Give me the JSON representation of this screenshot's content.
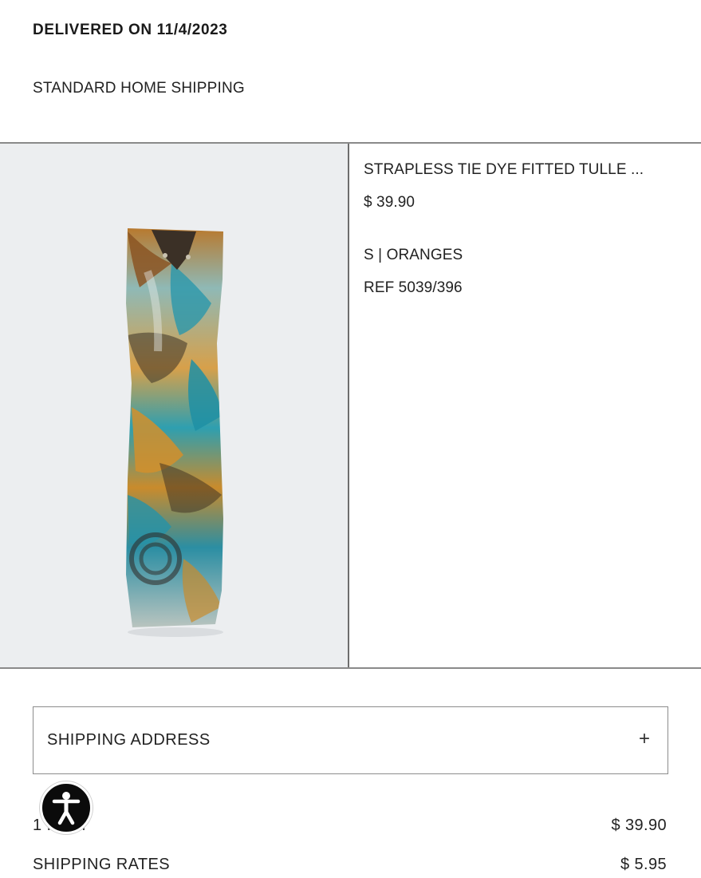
{
  "order": {
    "delivered_label": "DELIVERED ON 11/4/2023",
    "shipping_method": "STANDARD HOME SHIPPING"
  },
  "product": {
    "name": "STRAPLESS TIE DYE FITTED TULLE ...",
    "price": "$ 39.90",
    "variant": "S | ORANGES",
    "ref": "REF 5039/396"
  },
  "shipping_address": {
    "label": "SHIPPING ADDRESS",
    "expand_symbol": "+"
  },
  "summary": {
    "items_label": "1 ITEM",
    "items_total": "$ 39.90",
    "shipping_label": "SHIPPING RATES",
    "shipping_total": "$ 5.95"
  },
  "icons": {
    "accessibility": "accessibility-icon",
    "expand": "plus-icon"
  },
  "colors": {
    "border": "#8a8a8a",
    "photo_bg": "#eceef0",
    "accessibility_button": "#0b0b0b"
  }
}
